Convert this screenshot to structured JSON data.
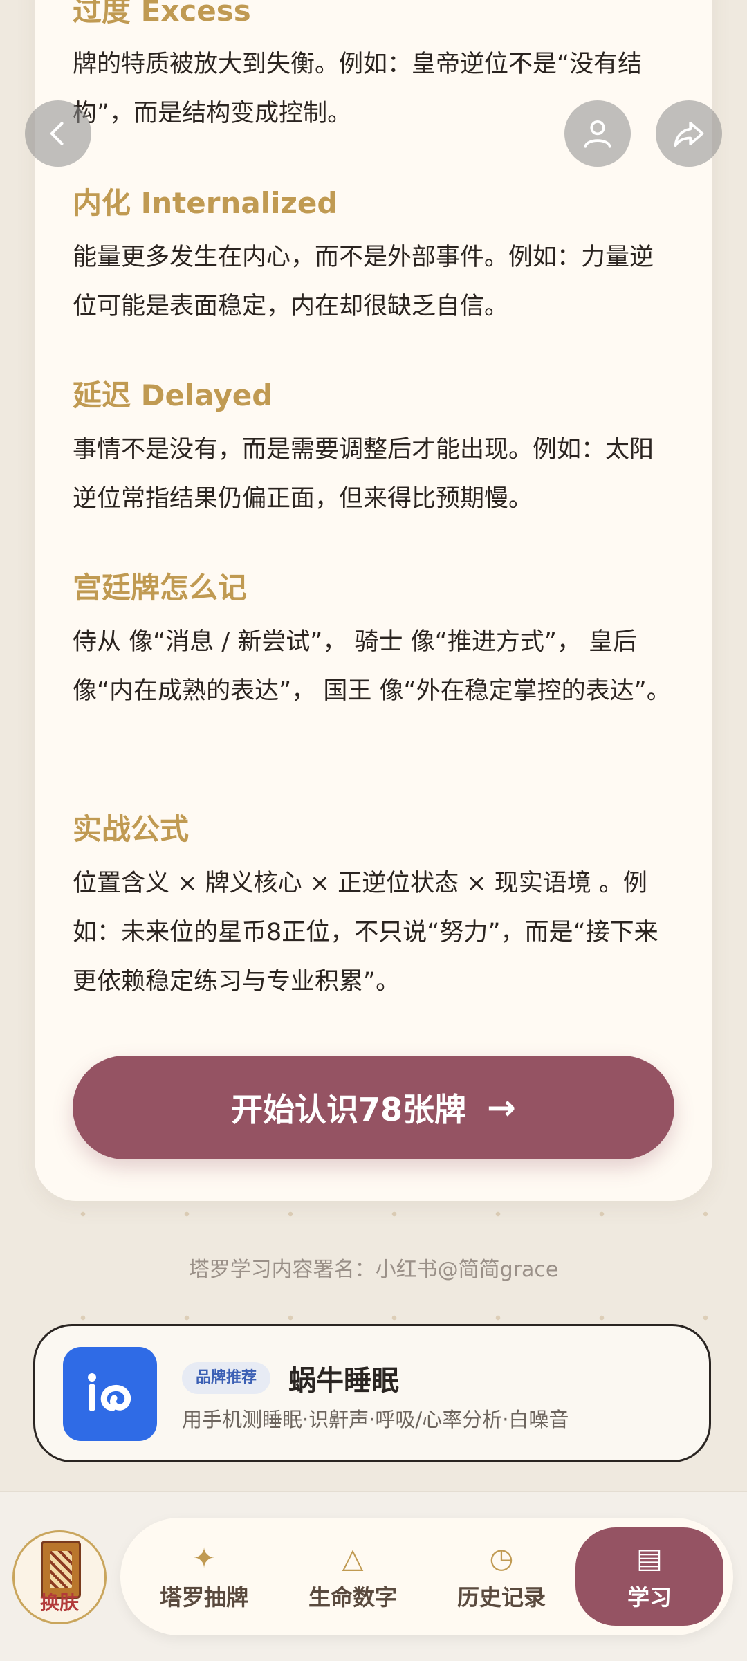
{
  "sections": [
    {
      "title": "过度 Excess",
      "body": "牌的特质被放大到失衡。例如：皇帝逆位不是“没有结构”，而是结构变成控制。"
    },
    {
      "title": "内化 Internalized",
      "body": "能量更多发生在内心，而不是外部事件。例如：力量逆位可能是表面稳定，内在却很缺乏自信。"
    },
    {
      "title": "延迟 Delayed",
      "body": "事情不是没有，而是需要调整后才能出现。例如：太阳逆位常指结果仍偏正面，但来得比预期慢。"
    },
    {
      "title": "宫廷牌怎么记",
      "body": "侍从 像“消息 / 新尝试”， 骑士 像“推进方式”， 皇后 像“内在成熟的表达”， 国王 像“外在稳定掌控的表达”。"
    },
    {
      "title": "实战公式",
      "body": "位置含义 × 牌义核心 × 正逆位状态 × 现实语境 。例如：未来位的星币8正位，不只说“努力”，而是“接下来更依赖稳定练习与专业积累”。"
    }
  ],
  "cta": {
    "label": "开始认识78张牌",
    "arrow": "→"
  },
  "top_buttons": {
    "back_icon": "chevron-left-icon",
    "profile_icon": "user-icon",
    "share_icon": "share-icon"
  },
  "credit": "塔罗学习内容署名：小红书@简简grace",
  "ad": {
    "tag": "品牌推荐",
    "name": "蜗牛睡眠",
    "desc": "用手机测睡眠·识鼾声·呼吸/心率分析·白噪音",
    "logo_color": "#2f6be6"
  },
  "bottom_nav": {
    "skin_label": "换肤",
    "tabs": [
      {
        "icon": "✦",
        "label": "塔罗抽牌"
      },
      {
        "icon": "△",
        "label": "生命数字"
      },
      {
        "icon": "◷",
        "label": "历史记录"
      },
      {
        "icon": "▤",
        "label": "学习"
      }
    ],
    "active_index": 3
  },
  "colors": {
    "accent": "#955363",
    "gold": "#c09a52",
    "background": "#efe9df",
    "card": "#fffaf3"
  }
}
